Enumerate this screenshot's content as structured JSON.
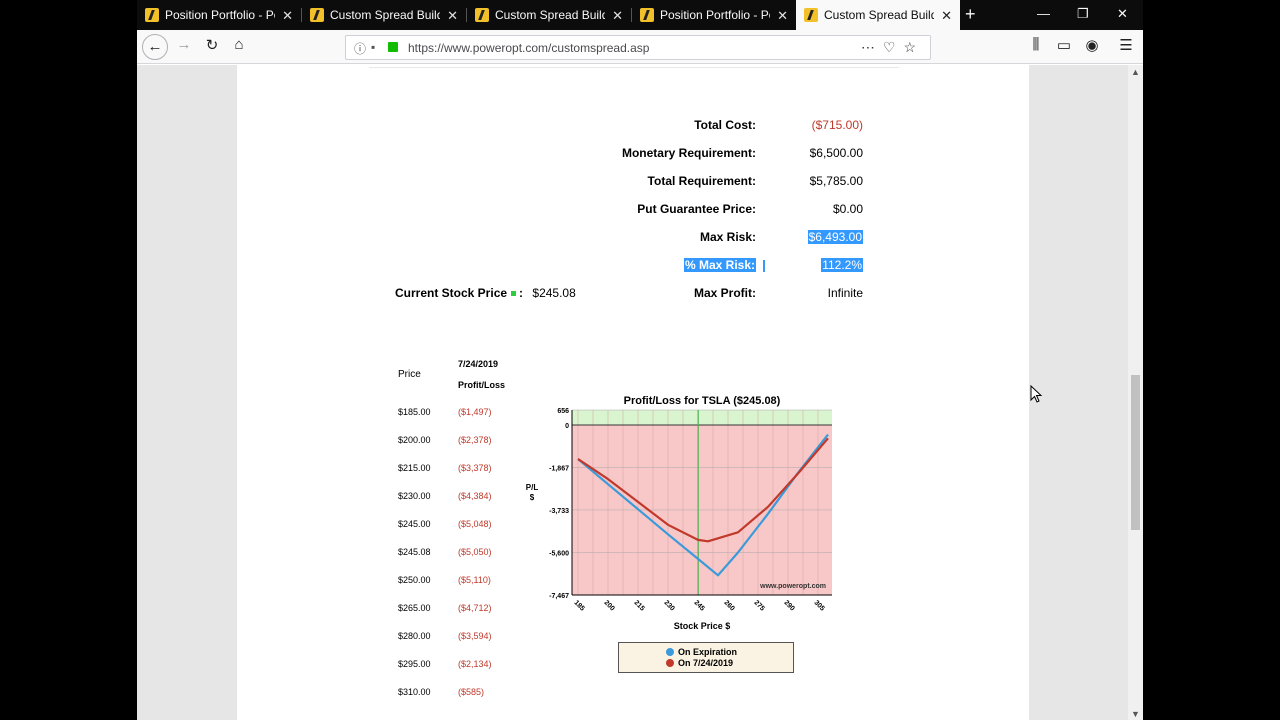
{
  "tabs": [
    {
      "title": "Position Portfolio - Pow",
      "active": false
    },
    {
      "title": "Custom Spread Builder -",
      "active": false
    },
    {
      "title": "Custom Spread Builder -",
      "active": false
    },
    {
      "title": "Position Portfolio - Pow",
      "active": false
    },
    {
      "title": "Custom Spread Builder",
      "active": true
    }
  ],
  "address_bar": {
    "url": "https://www.poweropt.com/customspread.asp"
  },
  "summary": {
    "total_cost_label": "Total Cost:",
    "total_cost": "($715.00)",
    "monetary_req_label": "Monetary Requirement:",
    "monetary_req": "$6,500.00",
    "total_req_label": "Total Requirement:",
    "total_req": "$5,785.00",
    "put_guarantee_label": "Put Guarantee Price:",
    "put_guarantee": "$0.00",
    "max_risk_label": "Max Risk:",
    "max_risk": "$6,493.00",
    "pct_max_risk_label": "% Max Risk:",
    "pct_max_risk": "112.2%",
    "max_profit_label": "Max Profit:",
    "max_profit": "Infinite",
    "current_price_label": "Current Stock Price",
    "current_price_sep": ":",
    "current_price": "$245.08"
  },
  "price_table": {
    "price_header": "Price",
    "date_header": "7/24/2019",
    "pl_header": "Profit/Loss",
    "rows": [
      {
        "price": "$185.00",
        "pl": "($1,497)"
      },
      {
        "price": "$200.00",
        "pl": "($2,378)"
      },
      {
        "price": "$215.00",
        "pl": "($3,378)"
      },
      {
        "price": "$230.00",
        "pl": "($4,384)"
      },
      {
        "price": "$245.00",
        "pl": "($5,048)"
      },
      {
        "price": "$245.08",
        "pl": "($5,050)"
      },
      {
        "price": "$250.00",
        "pl": "($5,110)"
      },
      {
        "price": "$265.00",
        "pl": "($4,712)"
      },
      {
        "price": "$280.00",
        "pl": "($3,594)"
      },
      {
        "price": "$295.00",
        "pl": "($2,134)"
      },
      {
        "price": "$310.00",
        "pl": "($585)"
      }
    ]
  },
  "chart_data": {
    "type": "line",
    "title": "Profit/Loss for TSLA ($245.08)",
    "xlabel": "Stock Price $",
    "ylabel": "P/L $",
    "watermark": "www.poweropt.com",
    "x_ticks": [
      "185",
      "200",
      "215",
      "230",
      "245",
      "260",
      "275",
      "290",
      "305"
    ],
    "y_ticks": [
      "656",
      "0",
      "-1,867",
      "-3,733",
      "-5,600",
      "-7,467"
    ],
    "xlim": [
      182,
      312
    ],
    "ylim": [
      -7467,
      656
    ],
    "current_price": 245.08,
    "colors": {
      "expiration": "#3b9ad9",
      "date": "#c0392b",
      "loss_zone": "#f8c8c8",
      "profit_zone": "#d8f5d0",
      "current_line": "#4caf50"
    },
    "series": [
      {
        "name": "On Expiration",
        "x": [
          185,
          200,
          215,
          230,
          245,
          255,
          265,
          280,
          295,
          310
        ],
        "y": [
          -1497,
          -2600,
          -3700,
          -4800,
          -5880,
          -6600,
          -5600,
          -3900,
          -2100,
          -420
        ]
      },
      {
        "name": "On 7/24/2019",
        "x": [
          185,
          200,
          215,
          230,
          245,
          250,
          265,
          280,
          295,
          310
        ],
        "y": [
          -1497,
          -2378,
          -3378,
          -4384,
          -5048,
          -5110,
          -4712,
          -3594,
          -2134,
          -585
        ]
      }
    ]
  }
}
